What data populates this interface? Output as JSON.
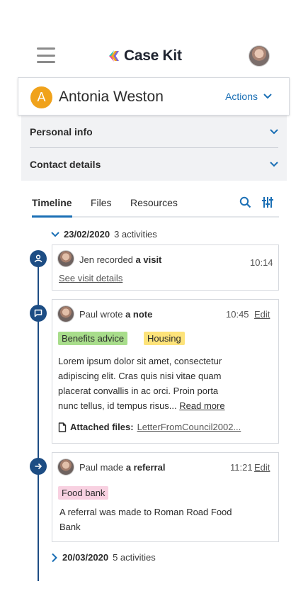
{
  "header": {
    "logo_text": "Case Kit"
  },
  "person": {
    "initial": "A",
    "name": "Antonia Weston",
    "actions_label": "Actions"
  },
  "accordion": [
    {
      "label": "Personal info"
    },
    {
      "label": "Contact details"
    }
  ],
  "tabs": [
    {
      "label": "Timeline",
      "active": true
    },
    {
      "label": "Files"
    },
    {
      "label": "Resources"
    }
  ],
  "timeline": {
    "group1": {
      "date": "23/02/2020",
      "count": "3 activities"
    },
    "group2": {
      "date": "20/03/2020",
      "count": "5 activities"
    },
    "entries": [
      {
        "author": "Jen",
        "verb": "recorded",
        "object": "a visit",
        "time": "10:14",
        "link": "See visit details"
      },
      {
        "author": "Paul",
        "verb": "wrote",
        "object": "a note",
        "time": "10:45",
        "edit": "Edit",
        "tags": [
          "Benefits advice",
          "Housing"
        ],
        "body_lines": [
          "Lorem ipsum dolor sit amet, consectetur",
          "adipiscing elit. Cras quis nisi vitae quam",
          "placerat convallis in ac orci. Proin porta",
          "nunc tellus, id tempus risus..."
        ],
        "read_more": "Read more",
        "attached_label": "Attached files:",
        "attached_file": "LetterFromCouncil2002..."
      },
      {
        "author": "Paul",
        "verb": "made",
        "object": "a referral",
        "time": "11:21",
        "edit": "Edit",
        "tags": [
          "Food bank"
        ],
        "body_lines": [
          "A referral was made to Roman Road Food",
          "Bank"
        ]
      }
    ]
  },
  "colors": {
    "accent_blue": "#1a6fb5",
    "timeline_navy": "#1d4d84",
    "avatar_orange": "#f0a21b",
    "tag_green": "#a8dd8b",
    "tag_yellow": "#fde37a",
    "tag_pink": "#f8d1e1"
  },
  "icons": [
    "hamburger-icon",
    "logo-icon",
    "chevron-down-icon",
    "search-icon",
    "filter-icon",
    "person-icon",
    "comment-icon",
    "arrow-right-icon",
    "file-icon",
    "chevron-right-icon"
  ]
}
